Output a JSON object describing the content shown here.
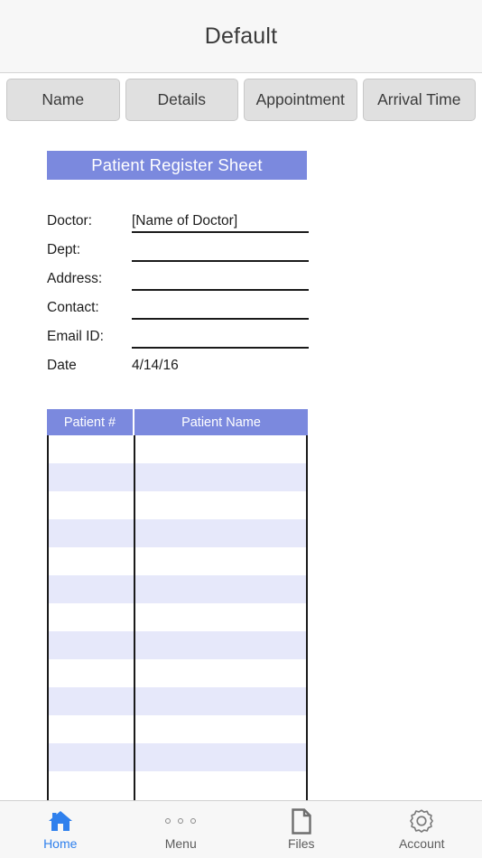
{
  "header": {
    "title": "Default"
  },
  "tabs": [
    {
      "label": "Name"
    },
    {
      "label": "Details"
    },
    {
      "label": "Appointment"
    },
    {
      "label": "Arrival Time"
    }
  ],
  "document": {
    "banner_title": "Patient Register Sheet",
    "banner_color": "#7b89de",
    "fields": [
      {
        "label": "Doctor:",
        "value": "[Name of Doctor]"
      },
      {
        "label": "Dept:",
        "value": ""
      },
      {
        "label": "Address:",
        "value": ""
      },
      {
        "label": "Contact:",
        "value": ""
      },
      {
        "label": "Email ID:",
        "value": ""
      },
      {
        "label": "Date",
        "value": "4/14/16"
      }
    ],
    "table": {
      "columns": [
        {
          "label": "Patient #"
        },
        {
          "label": "Patient Name"
        }
      ],
      "rows": [
        {
          "patient_number": "",
          "patient_name": ""
        },
        {
          "patient_number": "",
          "patient_name": ""
        },
        {
          "patient_number": "",
          "patient_name": ""
        },
        {
          "patient_number": "",
          "patient_name": ""
        },
        {
          "patient_number": "",
          "patient_name": ""
        },
        {
          "patient_number": "",
          "patient_name": ""
        },
        {
          "patient_number": "",
          "patient_name": ""
        },
        {
          "patient_number": "",
          "patient_name": ""
        },
        {
          "patient_number": "",
          "patient_name": ""
        },
        {
          "patient_number": "",
          "patient_name": ""
        },
        {
          "patient_number": "",
          "patient_name": ""
        },
        {
          "patient_number": "",
          "patient_name": ""
        },
        {
          "patient_number": "",
          "patient_name": ""
        }
      ]
    }
  },
  "bottom_nav": {
    "active_color": "#2f80ed",
    "items": [
      {
        "label": "Home",
        "icon": "home-icon",
        "active": true
      },
      {
        "label": "Menu",
        "icon": "dots-icon",
        "active": false
      },
      {
        "label": "Files",
        "icon": "document-icon",
        "active": false
      },
      {
        "label": "Account",
        "icon": "gear-icon",
        "active": false
      }
    ]
  }
}
